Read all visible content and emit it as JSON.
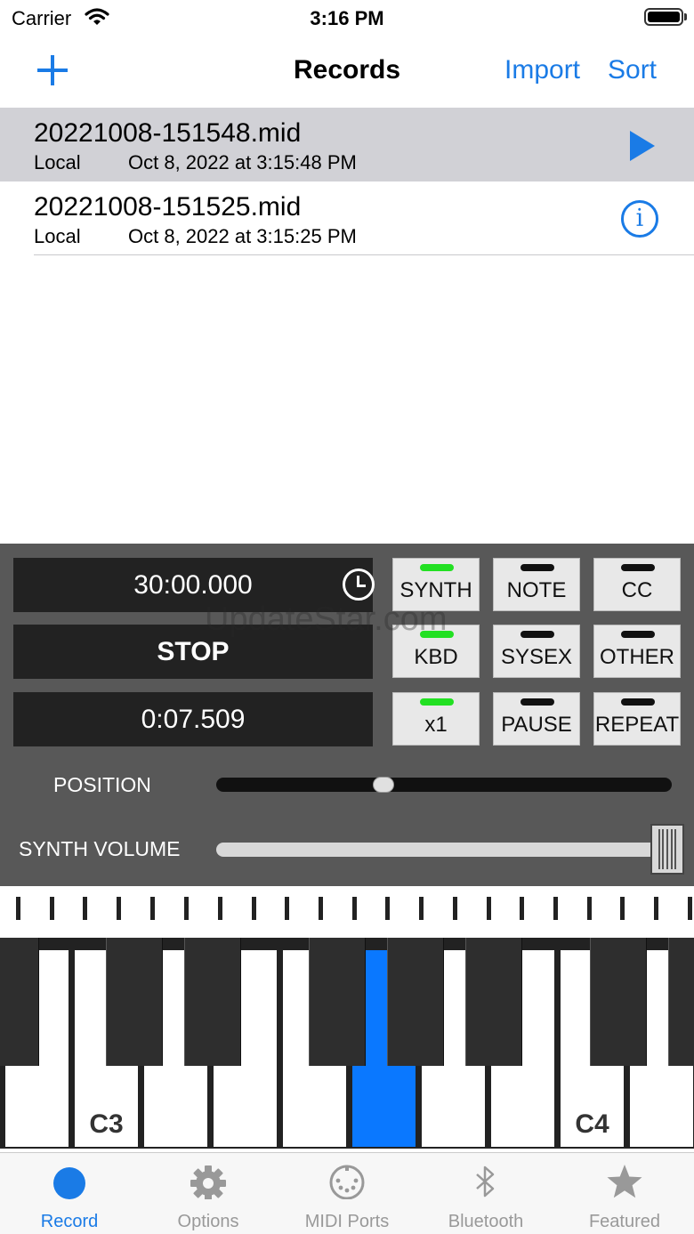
{
  "status": {
    "carrier": "Carrier",
    "time": "3:16 PM"
  },
  "nav": {
    "title": "Records",
    "import_label": "Import",
    "sort_label": "Sort"
  },
  "records": [
    {
      "name": "20221008-151548.mid",
      "location": "Local",
      "date": "Oct 8, 2022 at 3:15:48 PM",
      "selected": true,
      "accessory": "play-icon"
    },
    {
      "name": "20221008-151525.mid",
      "location": "Local",
      "date": "Oct 8, 2022 at 3:15:25 PM",
      "selected": false,
      "accessory": "info-icon"
    }
  ],
  "panel": {
    "duration": "30:00.000",
    "stop_label": "STOP",
    "elapsed": "0:07.509",
    "watermark": "UpdateStar.com",
    "toggles": [
      {
        "label": "SYNTH",
        "on": true
      },
      {
        "label": "NOTE",
        "on": false
      },
      {
        "label": "CC",
        "on": false
      },
      {
        "label": "KBD",
        "on": true
      },
      {
        "label": "SYSEX",
        "on": false
      },
      {
        "label": "OTHER",
        "on": false
      },
      {
        "label": "x1",
        "on": true
      },
      {
        "label": "PAUSE",
        "on": false
      },
      {
        "label": "REPEAT",
        "on": false
      }
    ],
    "position_label": "POSITION",
    "position_value": 0.36,
    "volume_label": "SYNTH VOLUME",
    "volume_value": 1.0
  },
  "piano": {
    "labels": {
      "c3": "C3",
      "c4": "C4"
    },
    "active_key": "G3"
  },
  "tabs": [
    {
      "label": "Record",
      "icon": "record-dot-icon",
      "active": true
    },
    {
      "label": "Options",
      "icon": "gear-icon",
      "active": false
    },
    {
      "label": "MIDI Ports",
      "icon": "midi-port-icon",
      "active": false
    },
    {
      "label": "Bluetooth",
      "icon": "bluetooth-icon",
      "active": false
    },
    {
      "label": "Featured",
      "icon": "star-icon",
      "active": false
    }
  ],
  "colors": {
    "accent": "#1a7be6",
    "led_on": "#22e022",
    "active_key": "#0a78ff",
    "panel": "#585858"
  }
}
